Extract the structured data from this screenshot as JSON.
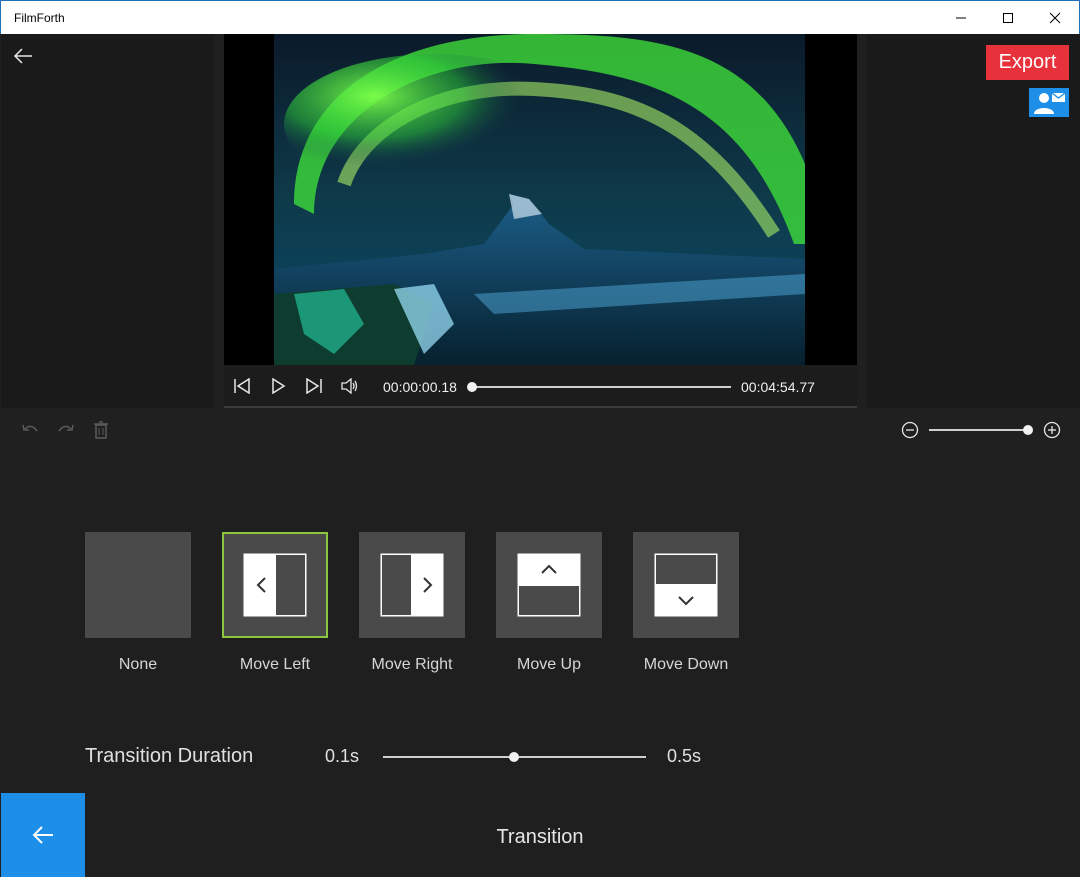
{
  "window": {
    "title": "FilmForth",
    "minimize_icon": "minimize-icon",
    "maximize_icon": "maximize-icon",
    "close_icon": "close-icon"
  },
  "header": {
    "back_icon": "arrow-left-icon",
    "export_label": "Export",
    "contact_icon": "contact-mail-icon"
  },
  "player": {
    "preview_image": "aurora-over-mountain",
    "current_time": "00:00:00.18",
    "total_time": "00:04:54.77",
    "progress_fraction": 0.0006
  },
  "toolbar": {
    "undo_icon": "undo-icon",
    "redo_icon": "redo-icon",
    "delete_icon": "trash-icon",
    "zoom_out_icon": "zoom-out-icon",
    "zoom_in_icon": "zoom-in-icon",
    "zoom_level_fraction": 1.0
  },
  "transitions": {
    "items": [
      {
        "label": "None",
        "selected": false
      },
      {
        "label": "Move Left",
        "selected": true
      },
      {
        "label": "Move Right",
        "selected": false
      },
      {
        "label": "Move Up",
        "selected": false
      },
      {
        "label": "Move Down",
        "selected": false
      }
    ],
    "duration_label": "Transition Duration",
    "duration_min": "0.1s",
    "duration_max": "0.5s",
    "duration_fraction": 0.5
  },
  "panel": {
    "title": "Transition",
    "back_icon": "arrow-left-icon"
  },
  "colors": {
    "accent_blue": "#1e8fe8",
    "export_red": "#e8323b",
    "selected_border": "#8cc63f",
    "background": "#1f1f1f"
  }
}
